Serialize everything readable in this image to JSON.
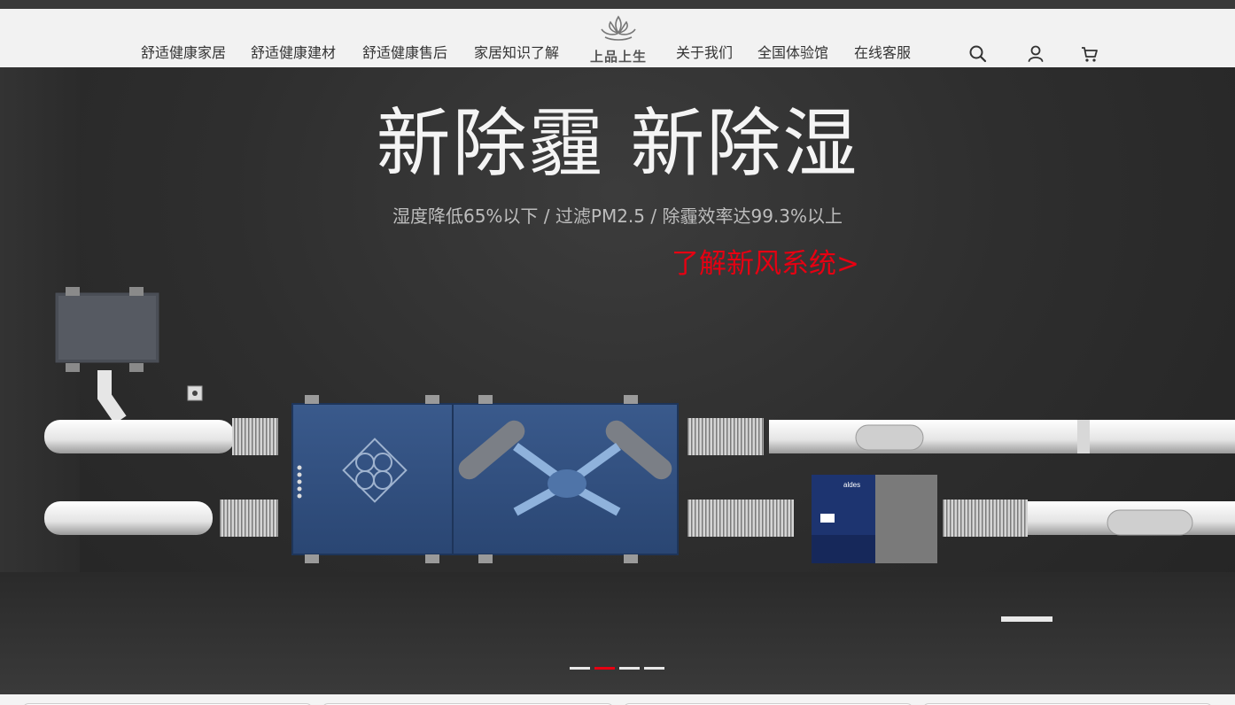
{
  "nav": {
    "left": [
      "舒适健康家居",
      "舒适健康建材",
      "舒适健康售后",
      "家居知识了解"
    ],
    "right": [
      "关于我们",
      "全国体验馆",
      "在线客服"
    ]
  },
  "logo": {
    "text": "上品上生"
  },
  "icons": [
    "search-icon",
    "user-icon",
    "cart-icon"
  ],
  "hero": {
    "title": "新除霾  新除湿",
    "subtitle": "湿度降低65%以下  /  过滤PM2.5  /  除霾效率达99.3%以上",
    "cta": "了解新风系统>",
    "product_brand": "aldes"
  },
  "slider": {
    "count": 4,
    "active_index": 1
  },
  "colors": {
    "accent": "#e60012",
    "header_bg": "#f2f2f2",
    "hero_bg": "#2e2e2e",
    "unit_blue": "#2f4f80"
  }
}
